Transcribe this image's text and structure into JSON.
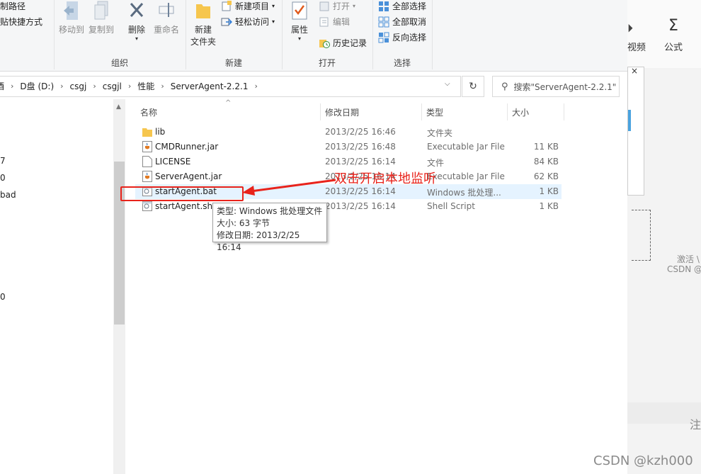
{
  "ribbon": {
    "clipboard": {
      "copy_path": "复制路径",
      "paste_shortcut": "粘贴快捷方式"
    },
    "organize": {
      "label": "组织",
      "move_to": "移动到",
      "copy_to": "复制到",
      "delete": "删除",
      "rename": "重命名"
    },
    "new": {
      "label": "新建",
      "new_folder": "新建\n文件夹",
      "new_folder_line1": "新建",
      "new_folder_line2": "文件夹",
      "new_item": "新建项目",
      "easy_access": "轻松访问"
    },
    "open": {
      "label": "打开",
      "properties": "属性",
      "open": "打开",
      "edit": "编辑",
      "history": "历史记录"
    },
    "select": {
      "label": "选择",
      "select_all": "全部选择",
      "select_none": "全部取消",
      "invert": "反向选择"
    }
  },
  "address": {
    "crumbs": [
      "D盘 (D:)",
      "csgj",
      "csgjl",
      "性能",
      "ServerAgent-2.2.1"
    ],
    "partial_left": "酒",
    "search_placeholder": "搜索\"ServerAgent-2.2.1\""
  },
  "nav_fragments": [
    "7",
    "0",
    "bad",
    "0"
  ],
  "columns": {
    "name": "名称",
    "date": "修改日期",
    "type": "类型",
    "size": "大小"
  },
  "files": [
    {
      "name": "lib",
      "date": "2013/2/25 16:46",
      "type": "文件夹",
      "size": "",
      "icon": "folder-icon"
    },
    {
      "name": "CMDRunner.jar",
      "date": "2013/2/25 16:48",
      "type": "Executable Jar File",
      "size": "11 KB",
      "icon": "jar-icon"
    },
    {
      "name": "LICENSE",
      "date": "2013/2/25 16:14",
      "type": "文件",
      "size": "84 KB",
      "icon": "file-icon"
    },
    {
      "name": "ServerAgent.jar",
      "date": "2013/2/25 16:14",
      "type": "Executable Jar File",
      "size": "62 KB",
      "icon": "jar-icon"
    },
    {
      "name": "startAgent.bat",
      "date": "2013/2/25 16:14",
      "type": "Windows 批处理...",
      "size": "1 KB",
      "icon": "bat-icon"
    },
    {
      "name": "startAgent.sh",
      "date": "2013/2/25 16:14",
      "type": "Shell Script",
      "size": "1 KB",
      "icon": "script-icon"
    }
  ],
  "tooltip": {
    "type": "类型: Windows 批处理文件",
    "size": "大小: 63 字节",
    "modified": "修改日期: 2013/2/25 16:14"
  },
  "annotation": "双击开启本地监听",
  "right_app": {
    "video_label": "视频",
    "formula_label": "公式",
    "activate": "激活 \\",
    "csdn_small": "CSDN @k",
    "edge_char": "注"
  },
  "watermark": "CSDN @kzh000",
  "colors": {
    "accent_red": "#e8231b",
    "selected_row": "#e5f3ff",
    "folder": "#f6c64e"
  }
}
